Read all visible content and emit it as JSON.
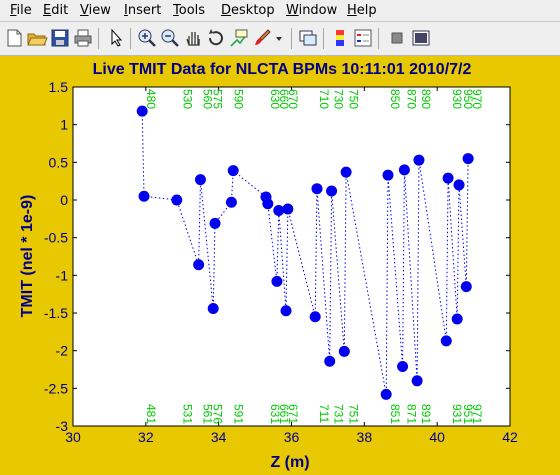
{
  "menu": [
    "File",
    "Edit",
    "View",
    "Insert",
    "Tools",
    "Desktop",
    "Window",
    "Help"
  ],
  "toolbar": [
    "new-figure-icon",
    "open-file-icon",
    "save-icon",
    "print-icon",
    "pointer-icon",
    "zoom-in-icon",
    "zoom-out-icon",
    "pan-icon",
    "rotate-3d-icon",
    "data-cursor-icon",
    "brush-icon",
    "brush-dropdown-icon",
    "link-plot-icon",
    "colorbar-icon",
    "legend-icon",
    "hide-plot-tools-icon",
    "show-plot-tools-icon"
  ],
  "colors": {
    "figure_bg": "#e8c800",
    "axes_bg": "#ffffff",
    "title": "#00008b",
    "series": "#0000ee",
    "bpm_labels": "#00cc00",
    "menu_bg": "#efefef"
  },
  "chart_data": {
    "type": "scatter",
    "title": "Live TMIT Data for NLCTA BPMs 10:11:01 2010/7/2",
    "xlabel": "Z (m)",
    "ylabel": "TMIT (nel * 1e-9)",
    "xlim": [
      30,
      42
    ],
    "ylim": [
      -3,
      1.5
    ],
    "xticks": [
      30,
      32,
      34,
      36,
      38,
      40,
      42
    ],
    "yticks": [
      1.5,
      1,
      0.5,
      0,
      -0.5,
      -1,
      -1.5,
      -2,
      -2.5,
      -3
    ],
    "xtick_labels": [
      "30",
      "32",
      "34",
      "36",
      "38",
      "40",
      "42"
    ],
    "ytick_labels": [
      "1.5",
      "1",
      "0.5",
      "0",
      "-0.5",
      "-1",
      "-1.5",
      "-2",
      "-2.5",
      "-3"
    ],
    "grid": false,
    "line_style": "dotted",
    "marker": "circle",
    "series": [
      {
        "x": [
          31.9,
          31.95,
          32.85,
          33.45,
          33.5,
          33.85,
          33.9,
          34.35,
          34.4,
          35.3,
          35.35,
          35.6,
          35.65,
          35.85,
          35.9,
          36.65,
          36.7,
          37.05,
          37.1,
          37.45,
          37.5,
          38.6,
          38.65,
          39.05,
          39.1,
          39.45,
          39.5,
          40.25,
          40.3,
          40.55,
          40.6,
          40.8,
          40.85
        ],
        "y": [
          1.18,
          0.05,
          0.0,
          -0.86,
          0.27,
          -1.44,
          -0.31,
          -0.03,
          0.39,
          0.04,
          -0.05,
          -1.08,
          -0.14,
          -1.47,
          -0.12,
          -1.55,
          0.15,
          -2.14,
          0.12,
          -2.01,
          0.37,
          -2.58,
          0.33,
          -2.21,
          0.4,
          -2.4,
          0.53,
          -1.87,
          0.29,
          -1.58,
          0.2,
          -1.15,
          0.55
        ]
      }
    ],
    "bpm_labels_top": [
      {
        "x": 31.9,
        "text": "480"
      },
      {
        "x": 32.9,
        "text": "530"
      },
      {
        "x": 33.45,
        "text": "560"
      },
      {
        "x": 33.72,
        "text": "575"
      },
      {
        "x": 34.3,
        "text": "590"
      },
      {
        "x": 35.3,
        "text": "630"
      },
      {
        "x": 35.55,
        "text": "660"
      },
      {
        "x": 35.8,
        "text": "670"
      },
      {
        "x": 36.65,
        "text": "710"
      },
      {
        "x": 37.05,
        "text": "730"
      },
      {
        "x": 37.45,
        "text": "750"
      },
      {
        "x": 38.6,
        "text": "850"
      },
      {
        "x": 39.05,
        "text": "870"
      },
      {
        "x": 39.45,
        "text": "890"
      },
      {
        "x": 40.3,
        "text": "930"
      },
      {
        "x": 40.6,
        "text": "950"
      },
      {
        "x": 40.85,
        "text": "970"
      }
    ],
    "bpm_labels_bottom": [
      {
        "x": 31.9,
        "text": "481"
      },
      {
        "x": 32.9,
        "text": "531"
      },
      {
        "x": 33.45,
        "text": "561"
      },
      {
        "x": 33.72,
        "text": "576"
      },
      {
        "x": 34.3,
        "text": "591"
      },
      {
        "x": 35.3,
        "text": "631"
      },
      {
        "x": 35.55,
        "text": "661"
      },
      {
        "x": 35.8,
        "text": "671"
      },
      {
        "x": 36.65,
        "text": "711"
      },
      {
        "x": 37.05,
        "text": "731"
      },
      {
        "x": 37.45,
        "text": "751"
      },
      {
        "x": 38.6,
        "text": "851"
      },
      {
        "x": 39.05,
        "text": "871"
      },
      {
        "x": 39.45,
        "text": "891"
      },
      {
        "x": 40.3,
        "text": "931"
      },
      {
        "x": 40.6,
        "text": "951"
      },
      {
        "x": 40.85,
        "text": "971"
      }
    ]
  }
}
